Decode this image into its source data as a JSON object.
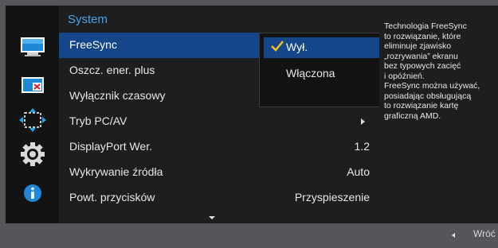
{
  "colors": {
    "accent_blue": "#4ea3e6",
    "selection_blue": "#16468a",
    "check_yellow": "#f3c019",
    "panel_dark": "#1d1e20"
  },
  "icons": [
    "monitor-icon",
    "picture-in-picture-icon",
    "resize-arrows-icon",
    "gear-icon",
    "info-icon"
  ],
  "menu": {
    "title": "System",
    "items": [
      {
        "label": "FreeSync",
        "value": ""
      },
      {
        "label": "Oszcz. ener. plus",
        "value": ""
      },
      {
        "label": "Wyłącznik czasowy",
        "value": ""
      },
      {
        "label": "Tryb PC/AV",
        "value": ""
      },
      {
        "label": "DisplayPort Wer.",
        "value": "1.2"
      },
      {
        "label": "Wykrywanie źródła",
        "value": "Auto"
      },
      {
        "label": "Powt. przycisków",
        "value": "Przyspieszenie"
      }
    ]
  },
  "submenu": {
    "options": [
      {
        "label": "Wył.",
        "selected": true
      },
      {
        "label": "Włączona",
        "selected": false
      }
    ]
  },
  "info": {
    "text": "Technologia FreeSync\nto rozwiązanie, które\neliminuje zjawisko\n„rozrywania” ekranu\nbez typowych zacięć\ni opóźnień.\nFreeSync można używać,\nposiadając obsługującą\nto rozwiązanie kartę\ngraficzną AMD."
  },
  "footer": {
    "back_label": "Wróć"
  }
}
